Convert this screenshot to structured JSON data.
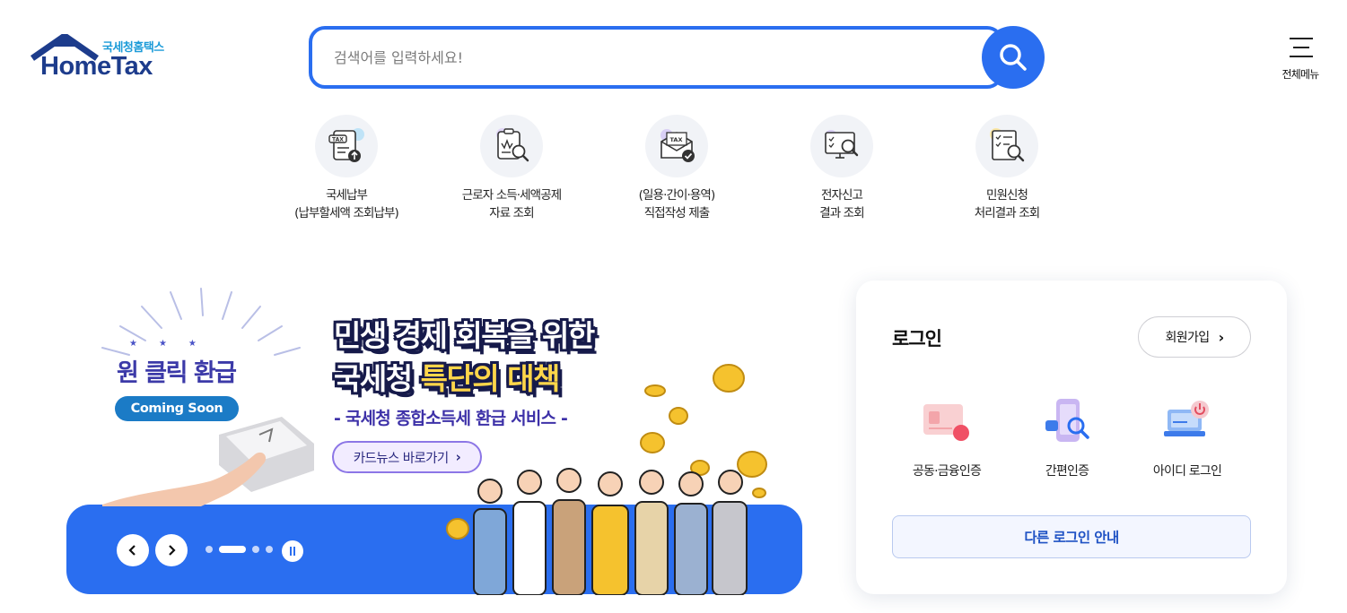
{
  "header": {
    "logo_sub": "국세청홈택스",
    "logo_main": "HomeTax",
    "search_placeholder": "검색어를 입력하세요!",
    "menu_label": "전체메뉴"
  },
  "quick_menu": [
    {
      "icon": "tax-payment-icon",
      "line1": "국세납부",
      "line2": "(납부할세액 조회납부)"
    },
    {
      "icon": "income-deduction-icon",
      "line1": "근로자 소득·세액공제",
      "line2": "자료 조회"
    },
    {
      "icon": "tax-mail-icon",
      "line1": "(일용·간이·용역)",
      "line2": "직접작성 제출"
    },
    {
      "icon": "monitor-search-icon",
      "line1": "전자신고",
      "line2": "결과 조회"
    },
    {
      "icon": "document-search-icon",
      "line1": "민원신청",
      "line2": "처리결과 조회"
    }
  ],
  "banner": {
    "key_title": "원 클릭 환급",
    "coming_soon": "Coming Soon",
    "headline_line1": "민생 경제 회복을 위한",
    "headline_line2_a": "국세청",
    "headline_line2_b": "특단의 대책",
    "subheadline": "- 국세청 종합소득세 환급 서비스 -",
    "card_button": "카드뉴스 바로가기",
    "card_button_arrow": "›",
    "slide_count": 4,
    "active_slide": 2,
    "colors": {
      "band": "#2a6ef0",
      "highlight": "#ffd64a",
      "outline": "#161a4a"
    }
  },
  "login": {
    "title": "로그인",
    "join_label": "회원가입",
    "join_arrow": "›",
    "options": [
      {
        "icon": "certificate-card-icon",
        "label": "공동·금융인증"
      },
      {
        "icon": "simple-auth-phone-icon",
        "label": "간편인증"
      },
      {
        "icon": "id-login-laptop-icon",
        "label": "아이디 로그인"
      }
    ],
    "other_login": "다른 로그인 안내"
  },
  "colors": {
    "primary": "#2a6ef0",
    "logo_navy": "#1d3c8c",
    "logo_sky": "#1c9bd8"
  }
}
